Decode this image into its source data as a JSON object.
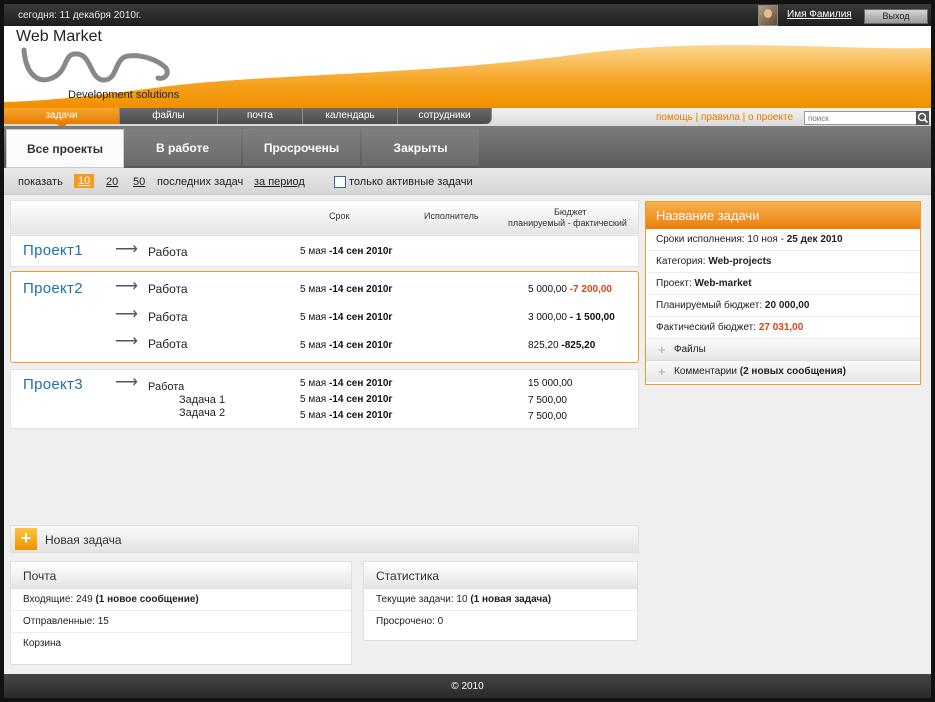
{
  "topbar": {
    "today": "сегодня: 11 декабря 2010г.",
    "username": "Имя Фамилия",
    "logout": "Выход"
  },
  "header": {
    "brand": "Web Market",
    "tagline": "Development solutions"
  },
  "nav": {
    "tabs": [
      "задачи",
      "файлы",
      "почта",
      "календарь",
      "сотрудники"
    ],
    "active": "задачи",
    "links": [
      "помощь",
      "правила",
      "о проекте"
    ],
    "search_placeholder": "поиск"
  },
  "project_tabs": {
    "items": [
      "Все проекты",
      "В работе",
      "Просрочены",
      "Закрыты"
    ],
    "active": "Все проекты"
  },
  "filter": {
    "show_label": "показать",
    "counts": [
      "10",
      "20",
      "50"
    ],
    "selected_count": "10",
    "last_tasks_label": "последних задач",
    "period_link": "за период",
    "only_active_label": "только активные задачи",
    "only_active_checked": false
  },
  "table": {
    "col_deadline": "Срок",
    "col_assignee": "Исполнитель",
    "col_budget": "Бюджет",
    "col_budget_sub": "планируемый - фактический"
  },
  "projects": [
    {
      "name": "Проект1",
      "rows": [
        {
          "work": "Работа",
          "date_start": "5 мая",
          "date_end": "-14 сен 2010г",
          "plan": "",
          "fact": ""
        }
      ]
    },
    {
      "name": "Проект2",
      "rows": [
        {
          "work": "Работа",
          "date_start": "5 мая",
          "date_end": "-14 сен 2010г",
          "plan": "5 000,00",
          "fact": "-7 200,00",
          "over": true
        },
        {
          "work": "Работа",
          "date_start": "5 мая",
          "date_end": "-14 сен 2010г",
          "plan": "3 000,00",
          "fact": "- 1 500,00",
          "over": false
        },
        {
          "work": "Работа",
          "date_start": "5 мая",
          "date_end": "-14 сен 2010г",
          "plan": "825,20",
          "fact": "-825,20",
          "over": false
        }
      ]
    },
    {
      "name": "Проект3",
      "work": "Работа",
      "rows": [
        {
          "task": "",
          "date_start": "5 мая",
          "date_end": "-14 сен 2010г",
          "plan": "15 000,00"
        },
        {
          "task": "Задача 1",
          "date_start": "5 мая",
          "date_end": "-14 сен 2010г",
          "plan": "7 500,00"
        },
        {
          "task": "Задача 2",
          "date_start": "5 мая",
          "date_end": "-14 сен 2010г",
          "plan": "7 500,00"
        }
      ]
    }
  ],
  "new_task": {
    "label": "Новая задача"
  },
  "mail": {
    "title": "Почта",
    "inbox_label": "Входящие: 249 ",
    "inbox_new": "(1 новое сообщение)",
    "sent": "Отправленные: 15",
    "trash": "Корзина"
  },
  "stats": {
    "title": "Статистика",
    "current_label": "Текущие задачи: 10 ",
    "current_new": "(1 новая задача)",
    "overdue": "Просрочено: 0"
  },
  "detail": {
    "title": "Название задачи",
    "deadline_label": "Сроки исполнения: 10 ноя - ",
    "deadline_end": "25 дек 2010",
    "category_label": "Категория: ",
    "category_value": "Web-projects",
    "project_label": "Проект: ",
    "project_value": "Web-market",
    "plan_label": "Планируемый бюджет: ",
    "plan_value": "20 000,00",
    "fact_label": "Фактический бюджет: ",
    "fact_value": "27 031,00",
    "files": "Файлы",
    "comments_label": "Комментарии ",
    "comments_new": "(2 новых сообщения)"
  },
  "footer": {
    "copyright": "© 2010"
  },
  "colors": {
    "accent": "#f39a2f",
    "link": "#1f6fb2",
    "over_budget": "#e04010"
  },
  "icons": {
    "search": "search-icon",
    "arrow": "arrow-right-icon",
    "plus": "plus-icon"
  }
}
